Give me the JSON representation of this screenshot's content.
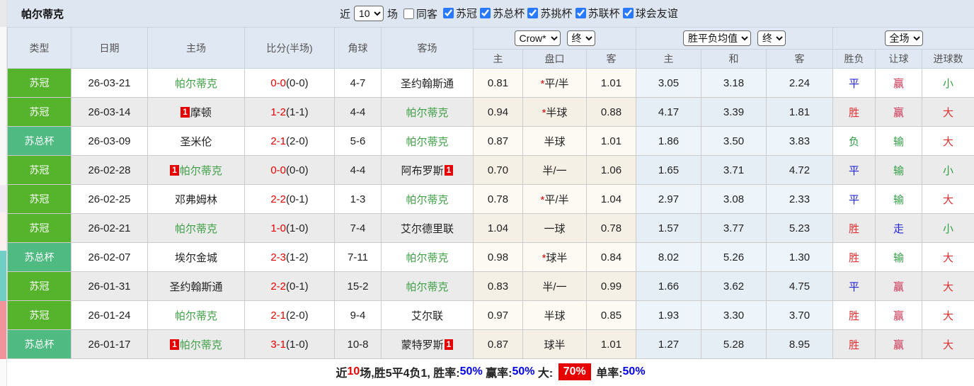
{
  "header": {
    "title": "帕尔蒂克",
    "near_label": "近",
    "near_count": "10",
    "games_label": "场",
    "same_opponent": {
      "label": "同客",
      "checked": false
    },
    "leagues": [
      {
        "label": "苏冠",
        "checked": true
      },
      {
        "label": "苏总杯",
        "checked": true
      },
      {
        "label": "苏挑杯",
        "checked": true
      },
      {
        "label": "苏联杯",
        "checked": true
      },
      {
        "label": "球会友谊",
        "checked": true
      }
    ]
  },
  "colors": {
    "accent_checkbox": "#2979ff",
    "league_badge": {
      "苏冠": "#55b42c",
      "苏总杯": "#4fba81"
    },
    "self_team_green": "#41a048",
    "score_red": "#e60000",
    "footer_value_blue": "#0000e6",
    "result": {
      "red": "#e03030",
      "blue": "#2424d8",
      "green": "#2f9e44",
      "crimson": "#cf3050"
    }
  },
  "table": {
    "columns": [
      "类型",
      "日期",
      "主场",
      "比分(半场)",
      "角球",
      "客场"
    ],
    "selects": {
      "odds_company": "Crow*",
      "odds_stage": "终",
      "avg_type": "胜平负均值",
      "avg_stage": "终",
      "scope": "全场"
    },
    "sub_columns": [
      "主",
      "盘口",
      "客",
      "主",
      "和",
      "客",
      "胜负",
      "让球",
      "进球数"
    ],
    "rows": [
      {
        "type": "苏冠",
        "date": "26-03-21",
        "home": "帕尔蒂克",
        "home_self": true,
        "home_rank": "",
        "score": "0-0",
        "half": "(0-0)",
        "corners": "4-7",
        "away": "圣约翰斯通",
        "away_self": false,
        "away_rank": "",
        "odds": {
          "home": "0.81",
          "line": "*平/半",
          "away": "1.01"
        },
        "avg": {
          "home": "3.05",
          "draw": "3.18",
          "away": "2.24"
        },
        "res": {
          "wdl": {
            "text": "平",
            "color": "blue"
          },
          "handicap": {
            "text": "赢",
            "color": "crimson"
          },
          "goals": {
            "text": "小",
            "color": "green"
          }
        }
      },
      {
        "type": "苏冠",
        "date": "26-03-14",
        "home": "摩顿",
        "home_self": false,
        "home_rank": "1",
        "score": "1-2",
        "half": "(1-1)",
        "corners": "4-4",
        "away": "帕尔蒂克",
        "away_self": true,
        "away_rank": "",
        "odds": {
          "home": "0.94",
          "line": "*半球",
          "away": "0.88"
        },
        "avg": {
          "home": "4.17",
          "draw": "3.39",
          "away": "1.81"
        },
        "res": {
          "wdl": {
            "text": "胜",
            "color": "red"
          },
          "handicap": {
            "text": "赢",
            "color": "crimson"
          },
          "goals": {
            "text": "大",
            "color": "red"
          }
        }
      },
      {
        "type": "苏总杯",
        "date": "26-03-09",
        "home": "圣米伦",
        "home_self": false,
        "home_rank": "",
        "score": "2-1",
        "half": "(2-0)",
        "corners": "5-6",
        "away": "帕尔蒂克",
        "away_self": true,
        "away_rank": "",
        "odds": {
          "home": "0.87",
          "line": "半球",
          "away": "1.01"
        },
        "avg": {
          "home": "1.86",
          "draw": "3.50",
          "away": "3.83"
        },
        "res": {
          "wdl": {
            "text": "负",
            "color": "green"
          },
          "handicap": {
            "text": "输",
            "color": "green"
          },
          "goals": {
            "text": "大",
            "color": "red"
          }
        }
      },
      {
        "type": "苏冠",
        "date": "26-02-28",
        "home": "帕尔蒂克",
        "home_self": true,
        "home_rank": "1",
        "score": "0-0",
        "half": "(0-0)",
        "corners": "4-4",
        "away": "阿布罗斯",
        "away_self": false,
        "away_rank": "1",
        "odds": {
          "home": "0.70",
          "line": "半/一",
          "away": "1.06"
        },
        "avg": {
          "home": "1.65",
          "draw": "3.71",
          "away": "4.72"
        },
        "res": {
          "wdl": {
            "text": "平",
            "color": "blue"
          },
          "handicap": {
            "text": "输",
            "color": "green"
          },
          "goals": {
            "text": "小",
            "color": "green"
          }
        }
      },
      {
        "type": "苏冠",
        "date": "26-02-25",
        "home": "邓弗姆林",
        "home_self": false,
        "home_rank": "",
        "score": "2-2",
        "half": "(0-1)",
        "corners": "1-3",
        "away": "帕尔蒂克",
        "away_self": true,
        "away_rank": "",
        "odds": {
          "home": "0.78",
          "line": "*平/半",
          "away": "1.04"
        },
        "avg": {
          "home": "2.97",
          "draw": "3.08",
          "away": "2.33"
        },
        "res": {
          "wdl": {
            "text": "平",
            "color": "blue"
          },
          "handicap": {
            "text": "输",
            "color": "green"
          },
          "goals": {
            "text": "大",
            "color": "red"
          }
        }
      },
      {
        "type": "苏冠",
        "date": "26-02-21",
        "home": "帕尔蒂克",
        "home_self": true,
        "home_rank": "",
        "score": "1-0",
        "half": "(1-0)",
        "corners": "7-4",
        "away": "艾尔德里联",
        "away_self": false,
        "away_rank": "",
        "odds": {
          "home": "1.04",
          "line": "一球",
          "away": "0.78"
        },
        "avg": {
          "home": "1.57",
          "draw": "3.77",
          "away": "5.23"
        },
        "res": {
          "wdl": {
            "text": "胜",
            "color": "red"
          },
          "handicap": {
            "text": "走",
            "color": "blue"
          },
          "goals": {
            "text": "小",
            "color": "green"
          }
        }
      },
      {
        "type": "苏总杯",
        "date": "26-02-07",
        "home": "埃尔金城",
        "home_self": false,
        "home_rank": "",
        "score": "2-3",
        "half": "(1-2)",
        "corners": "7-11",
        "away": "帕尔蒂克",
        "away_self": true,
        "away_rank": "",
        "odds": {
          "home": "0.98",
          "line": "*球半",
          "away": "0.84"
        },
        "avg": {
          "home": "8.02",
          "draw": "5.26",
          "away": "1.30"
        },
        "res": {
          "wdl": {
            "text": "胜",
            "color": "red"
          },
          "handicap": {
            "text": "输",
            "color": "green"
          },
          "goals": {
            "text": "大",
            "color": "red"
          }
        }
      },
      {
        "type": "苏冠",
        "date": "26-01-31",
        "home": "圣约翰斯通",
        "home_self": false,
        "home_rank": "",
        "score": "2-2",
        "half": "(0-1)",
        "corners": "15-2",
        "away": "帕尔蒂克",
        "away_self": true,
        "away_rank": "",
        "odds": {
          "home": "0.83",
          "line": "半/一",
          "away": "0.99"
        },
        "avg": {
          "home": "1.66",
          "draw": "3.62",
          "away": "4.75"
        },
        "res": {
          "wdl": {
            "text": "平",
            "color": "blue"
          },
          "handicap": {
            "text": "赢",
            "color": "crimson"
          },
          "goals": {
            "text": "大",
            "color": "red"
          }
        }
      },
      {
        "type": "苏冠",
        "date": "26-01-24",
        "home": "帕尔蒂克",
        "home_self": true,
        "home_rank": "",
        "score": "2-1",
        "half": "(2-0)",
        "corners": "9-4",
        "away": "艾尔联",
        "away_self": false,
        "away_rank": "",
        "odds": {
          "home": "0.97",
          "line": "半球",
          "away": "0.85"
        },
        "avg": {
          "home": "1.93",
          "draw": "3.30",
          "away": "3.70"
        },
        "res": {
          "wdl": {
            "text": "胜",
            "color": "red"
          },
          "handicap": {
            "text": "赢",
            "color": "crimson"
          },
          "goals": {
            "text": "大",
            "color": "red"
          }
        }
      },
      {
        "type": "苏总杯",
        "date": "26-01-17",
        "home": "帕尔蒂克",
        "home_self": true,
        "home_rank": "1",
        "score": "3-1",
        "half": "(1-0)",
        "corners": "10-8",
        "away": "蒙特罗斯",
        "away_self": false,
        "away_rank": "1",
        "odds": {
          "home": "0.87",
          "line": "球半",
          "away": "1.01"
        },
        "avg": {
          "home": "1.27",
          "draw": "5.28",
          "away": "8.95"
        },
        "res": {
          "wdl": {
            "text": "胜",
            "color": "red"
          },
          "handicap": {
            "text": "赢",
            "color": "crimson"
          },
          "goals": {
            "text": "大",
            "color": "red"
          }
        }
      }
    ]
  },
  "footer": {
    "segments": [
      {
        "text": "近",
        "style": "plain"
      },
      {
        "text": "10",
        "style": "red"
      },
      {
        "text": "场,胜5平4负1, ",
        "style": "plain"
      },
      {
        "text": "胜率:",
        "style": "plain"
      },
      {
        "text": "50%",
        "style": "blue"
      },
      {
        "text": " 赢率:",
        "style": "plain"
      },
      {
        "text": "50%",
        "style": "blue"
      },
      {
        "text": " 大: ",
        "style": "plain"
      },
      {
        "text": "70%",
        "style": "red-badge"
      },
      {
        "text": " 单率:",
        "style": "plain"
      },
      {
        "text": "50%",
        "style": "blue"
      }
    ]
  }
}
